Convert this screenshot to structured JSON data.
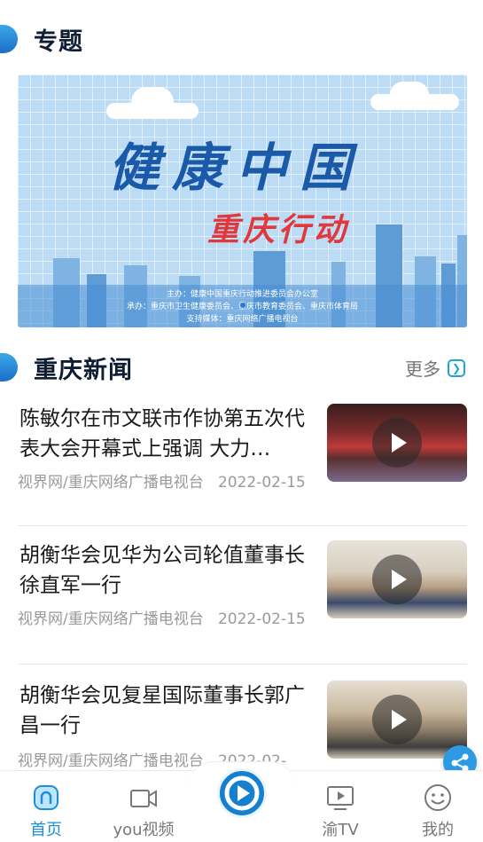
{
  "topics": {
    "title": "专题"
  },
  "banner": {
    "headline": "健康中国",
    "subheadline": "重庆行动",
    "credits": [
      "主办：健康中国重庆行动推进委员会办公室",
      "承办：重庆市卫生健康委员会、重庆市教育委员会、重庆市体育局",
      "支持媒体：重庆网络广播电视台"
    ]
  },
  "news_section": {
    "title": "重庆新闻",
    "more_label": "更多"
  },
  "news": [
    {
      "title": "陈敏尔在市文联市作协第五次代表大会开幕式上强调 大力…",
      "source": "视界网/重庆网络广播电视台",
      "date": "2022-02-15"
    },
    {
      "title": "胡衡华会见华为公司轮值董事长徐直军一行",
      "source": "视界网/重庆网络广播电视台",
      "date": "2022-02-15"
    },
    {
      "title": "胡衡华会见复星国际董事长郭广昌一行",
      "source": "视界网/重庆网络广播电视台",
      "date": "2022-02-"
    }
  ],
  "tabbar": {
    "home": "首页",
    "you_video": "you视频",
    "yu_tv": "渝TV",
    "mine": "我的"
  },
  "colors": {
    "accent": "#1a8fd6",
    "banner_red": "#e0393d",
    "banner_blue": "#1b5aa8"
  }
}
